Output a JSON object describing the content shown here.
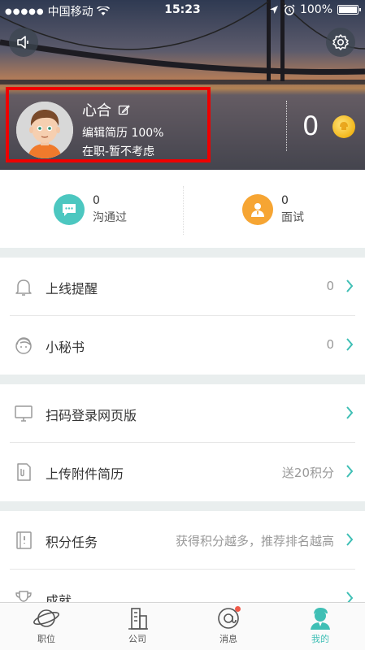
{
  "status_bar": {
    "signal_dots": "●●●●●",
    "carrier": "中国移动",
    "time": "15:23",
    "battery": "100%"
  },
  "header": {
    "speaker_icon": "speaker-icon",
    "settings_icon": "gear-icon",
    "profile": {
      "name": "心合",
      "resume_line": "编辑简历 100%",
      "status_line": "在职-暂不考虑"
    },
    "points": "0",
    "highlight_color": "#ee0000"
  },
  "stats": {
    "communicated": {
      "count": "0",
      "label": "沟通过"
    },
    "interview": {
      "count": "0",
      "label": "面试"
    }
  },
  "list": {
    "online_reminder": {
      "title": "上线提醒",
      "value": "0"
    },
    "secretary": {
      "title": "小秘书",
      "value": "0"
    },
    "scan_login": {
      "title": "扫码登录网页版",
      "value": ""
    },
    "upload_resume": {
      "title": "上传附件简历",
      "value": "送20积分"
    },
    "points_task": {
      "title": "积分任务",
      "value": "获得积分越多，推荐排名越高"
    },
    "achievements": {
      "title": "成就",
      "value": ""
    }
  },
  "tabbar": {
    "jobs": "职位",
    "company": "公司",
    "messages": "消息",
    "mine": "我的",
    "active": "mine",
    "accent_color": "#3fbfb5"
  }
}
